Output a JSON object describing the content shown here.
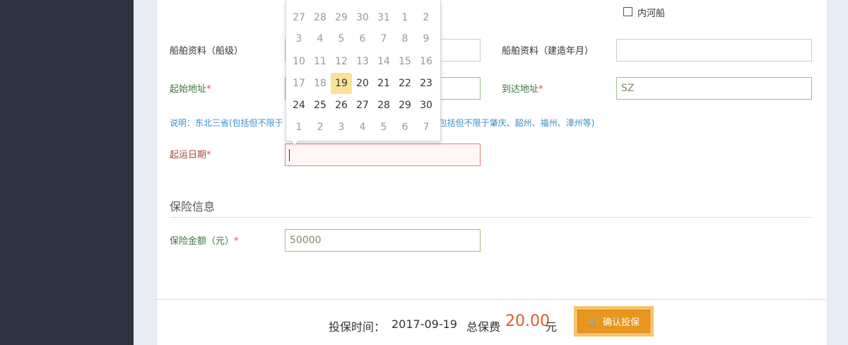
{
  "form": {
    "river_ship_label": "内河船",
    "ship_grade_label": "船舶资料（船级）",
    "ship_build_label": "船舶资料（建造年月）",
    "start_addr_label": "起始地址",
    "end_addr_label": "到达地址",
    "end_addr_value": "SZ",
    "note_left": "说明：东北三省(包括但不限于",
    "note_right": "(包括但不限于肇庆、韶州、福州、漳州等)",
    "ship_date_label": "起运日期",
    "required_mark": "*"
  },
  "insurance": {
    "section_title": "保险信息",
    "amount_label": "保险金额（元）",
    "amount_value": "50000"
  },
  "footer": {
    "time_label": "投保时间：",
    "time_value": "2017-09-19",
    "total_label": "总保费",
    "total_value": "20.00",
    "currency": "元",
    "confirm_label": "确认投保"
  },
  "datepicker": {
    "weeks": [
      [
        {
          "d": "27",
          "o": true
        },
        {
          "d": "28",
          "o": true
        },
        {
          "d": "29",
          "o": true
        },
        {
          "d": "30",
          "o": true
        },
        {
          "d": "31",
          "o": true
        },
        {
          "d": "1",
          "o": true
        },
        {
          "d": "2",
          "o": true
        }
      ],
      [
        {
          "d": "3",
          "o": true
        },
        {
          "d": "4",
          "o": true
        },
        {
          "d": "5",
          "o": true
        },
        {
          "d": "6",
          "o": true
        },
        {
          "d": "7",
          "o": true
        },
        {
          "d": "8",
          "o": true
        },
        {
          "d": "9",
          "o": true
        }
      ],
      [
        {
          "d": "10",
          "o": true
        },
        {
          "d": "11",
          "o": true
        },
        {
          "d": "12",
          "o": true
        },
        {
          "d": "13",
          "o": true
        },
        {
          "d": "14",
          "o": true
        },
        {
          "d": "15",
          "o": true
        },
        {
          "d": "16",
          "o": true
        }
      ],
      [
        {
          "d": "17",
          "o": true
        },
        {
          "d": "18",
          "o": true
        },
        {
          "d": "19",
          "t": true
        },
        {
          "d": "20"
        },
        {
          "d": "21"
        },
        {
          "d": "22"
        },
        {
          "d": "23"
        }
      ],
      [
        {
          "d": "24"
        },
        {
          "d": "25"
        },
        {
          "d": "26"
        },
        {
          "d": "27"
        },
        {
          "d": "28"
        },
        {
          "d": "29"
        },
        {
          "d": "30"
        }
      ],
      [
        {
          "d": "1",
          "o": true
        },
        {
          "d": "2",
          "o": true
        },
        {
          "d": "3",
          "o": true
        },
        {
          "d": "4",
          "o": true
        },
        {
          "d": "5",
          "o": true
        },
        {
          "d": "6",
          "o": true
        },
        {
          "d": "7",
          "o": true
        }
      ]
    ]
  },
  "colors": {
    "sidebar": "#2e3440",
    "accent_button": "#e8961e",
    "price": "#e05a2b",
    "valid_border": "#9bc37c",
    "error_border": "#d9837e"
  }
}
